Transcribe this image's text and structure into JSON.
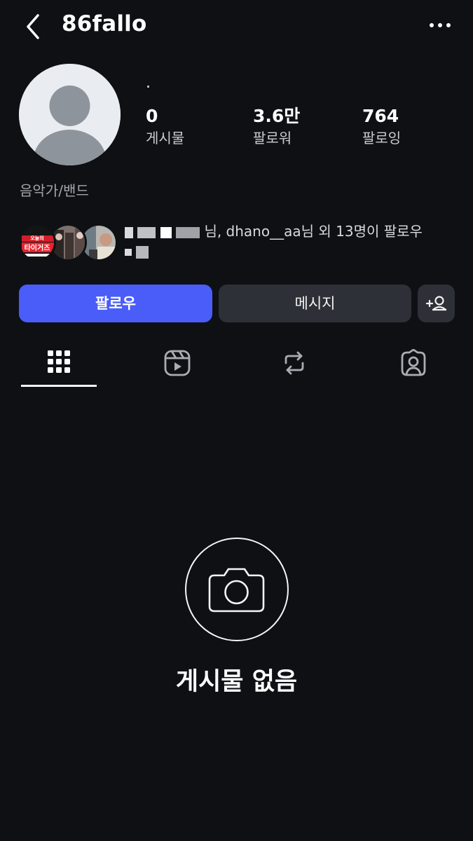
{
  "header": {
    "username": "86fallo",
    "back_icon": "chevron-left-icon",
    "more_icon": "more-horizontal-icon"
  },
  "profile": {
    "display_name": ".",
    "stats": {
      "posts": {
        "value": "0",
        "label": "게시물"
      },
      "followers": {
        "value": "3.6만",
        "label": "팔로워"
      },
      "following": {
        "value": "764",
        "label": "팔로잉"
      }
    },
    "category": "음악가/밴드"
  },
  "followed_by": {
    "text_visible": "님, dhano__aa님 외 13명이 팔로우",
    "mutual_badge_text": "타이거즈",
    "mutual_badge_small": "오늘의"
  },
  "buttons": {
    "follow": "팔로우",
    "message": "메시지",
    "add_person_icon": "add-person-icon"
  },
  "tabs": [
    {
      "name": "grid",
      "icon": "grid-icon",
      "active": true
    },
    {
      "name": "reels",
      "icon": "reels-icon",
      "active": false
    },
    {
      "name": "reposts",
      "icon": "repost-icon",
      "active": false
    },
    {
      "name": "tagged",
      "icon": "tagged-person-icon",
      "active": false
    }
  ],
  "empty_state": {
    "icon": "camera-icon",
    "title": "게시물 없음"
  },
  "colors": {
    "background": "#0e1014",
    "follow_button": "#4a5df9",
    "secondary_button": "#2d3036",
    "text_primary": "#ffffff",
    "text_secondary": "#a3a7ad"
  }
}
